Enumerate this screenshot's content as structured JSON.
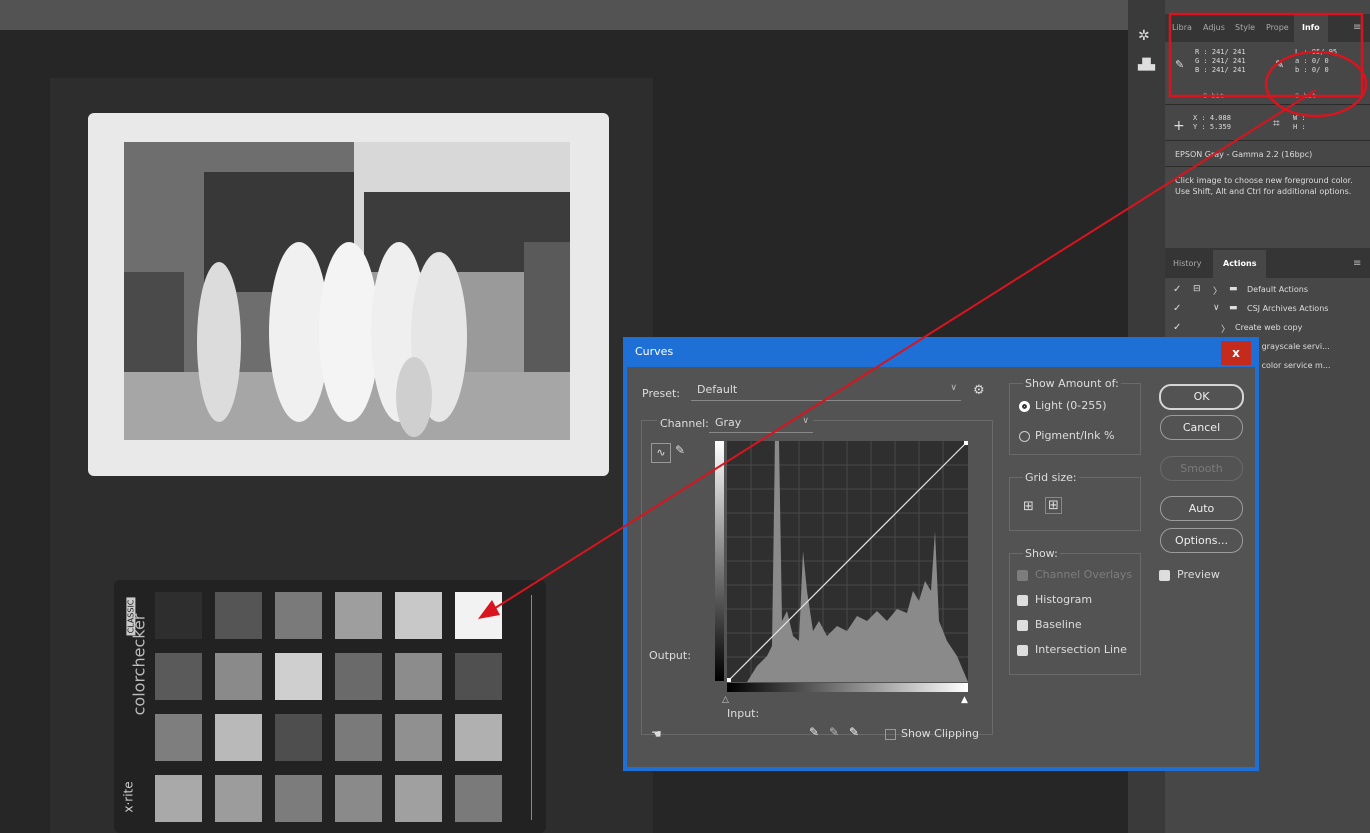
{
  "panel": {
    "tabs": [
      "Libra",
      "Adjus",
      "Style",
      "Prope",
      "Info"
    ],
    "info": {
      "rgb_lines": [
        "R :  241/  241",
        "G :  241/  241",
        "B :  241/  241"
      ],
      "lab_lines": [
        "L :    95/  95",
        "a :     0/   0",
        "b :     0/   0"
      ],
      "depth_left": "8-bit",
      "depth_right": "8-bit",
      "xy_lines": [
        "X :   4.088",
        "Y :   5.359"
      ],
      "wh_lines": [
        "W :",
        "H :"
      ],
      "profile": "EPSON Gray - Gamma 2.2 (16bpc)",
      "help_text": "Click image to choose new foreground color.  Use Shift, Alt and Ctrl for additional options."
    },
    "history_tabs": [
      "History",
      "Actions"
    ],
    "actions": [
      {
        "label": "Default Actions"
      },
      {
        "label": "CSJ Archives Actions"
      },
      {
        "label": "Create web copy"
      },
      {
        "label": "te grayscale servi..."
      },
      {
        "label": "te color service m..."
      }
    ]
  },
  "checker": {
    "brand": "colorchecker",
    "classic": "CLASSIC",
    "maker": "x·rite"
  },
  "curves": {
    "title": "Curves",
    "close": "x",
    "preset_label": "Preset:",
    "preset_value": "Default",
    "channel_label": "Channel:",
    "channel_value": "Gray",
    "output_label": "Output:",
    "input_label": "Input:",
    "show_clipping": "Show Clipping",
    "show_amount_title": "Show Amount of:",
    "light_option": "Light  (0-255)",
    "pigment_option": "Pigment/Ink %",
    "grid_title": "Grid size:",
    "show_title": "Show:",
    "show_options": [
      "Channel Overlays",
      "Histogram",
      "Baseline",
      "Intersection Line"
    ],
    "buttons": {
      "ok": "OK",
      "cancel": "Cancel",
      "smooth": "Smooth",
      "auto": "Auto",
      "options": "Options..."
    },
    "preview": "Preview"
  },
  "colors": {
    "dialog_blue": "#1e6fd6",
    "annotation_red": "#d9141e",
    "dialog_bg": "#535353"
  }
}
